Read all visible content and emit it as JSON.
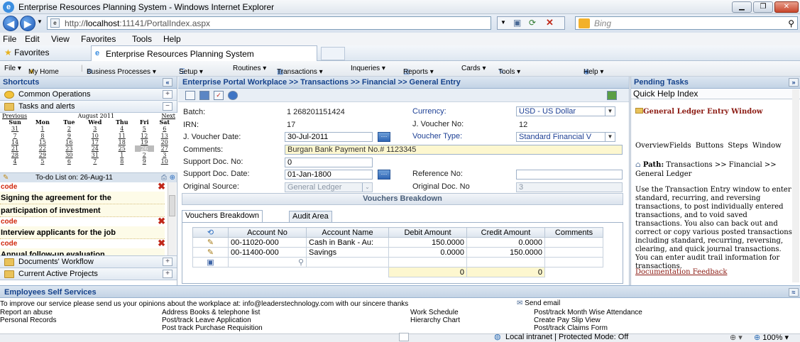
{
  "window": {
    "title": "Enterprise Resources Planning System - Windows Internet Explorer"
  },
  "browser": {
    "url_prefix": "http://",
    "url_host": "localhost",
    "url_path": ":11141/PortalIndex.aspx",
    "search_placeholder": "Bing",
    "tab_title": "Enterprise Resources Planning System",
    "favorites_label": "Favorites"
  },
  "menu": [
    "File",
    "Edit",
    "View",
    "Favorites",
    "Tools",
    "Help"
  ],
  "app_toolbar": [
    "File ▾",
    "My Home",
    "Business Processes ▾",
    "Setup ▾",
    "Routines ▾",
    "Transactions ▾",
    "Inqueries ▾",
    "Reports ▾",
    "Cards ▾",
    "Tools ▾",
    "Help ▾"
  ],
  "shortcuts": {
    "title": "Shortcuts",
    "sections": [
      "Common Operations",
      "Tasks and alerts"
    ],
    "calendar": {
      "prev": "Previous",
      "next": "Next",
      "month": "August 2011",
      "days": [
        "Sun",
        "Mon",
        "Tue",
        "Wed",
        "Thu",
        "Fri",
        "Sat"
      ],
      "weeks": [
        [
          "31",
          "1",
          "2",
          "3",
          "4",
          "5",
          "6"
        ],
        [
          "7",
          "8",
          "9",
          "10",
          "11",
          "12",
          "13"
        ],
        [
          "14",
          "15",
          "16",
          "17",
          "18",
          "19",
          "20"
        ],
        [
          "21",
          "22",
          "23",
          "24",
          "25",
          "26",
          "27"
        ],
        [
          "28",
          "29",
          "30",
          "31",
          "1",
          "2",
          "3"
        ],
        [
          "4",
          "5",
          "6",
          "7",
          "8",
          "9",
          "10"
        ]
      ]
    },
    "todo": "To-do List on: 26-Aug-11",
    "notes": [
      {
        "tag": "code",
        "text": "Signing the agreement for the"
      },
      {
        "tag": "",
        "text": "participation of investment"
      },
      {
        "tag": "code",
        "text": "Interview applicants for the job"
      },
      {
        "tag": "code",
        "text": "Annual follow-up evaluation"
      }
    ],
    "bottom_sections": [
      "Documents' Workflow",
      "Current Active Projects"
    ]
  },
  "breadcrumb": "Enterprise Portal Workplace >> Transactions >> Financial >> General Entry",
  "form": {
    "batch_label": "Batch:",
    "batch": "1 268201151424",
    "irn_label": "IRN:",
    "irn": "17",
    "jvdate_label": "J. Voucher Date:",
    "jvdate": "30-Jul-2011",
    "comments_label": "Comments:",
    "comments": "Burgan Bank Payment No.# 1123345",
    "supdoc_label": "Support Doc. No:",
    "supdoc": "0",
    "supdate_label": "Support Doc. Date:",
    "supdate": "01-Jan-1800",
    "origsrc_label": "Original Source:",
    "origsrc": "General Ledger",
    "currency_label": "Currency:",
    "currency": "USD - US Dollar",
    "jvno_label": "J. Voucher No:",
    "jvno": "12",
    "vtype_label": "Voucher Type:",
    "vtype": "Standard Financial V",
    "ref_label": "Reference No:",
    "ref": "",
    "origdoc_label": "Original Doc. No",
    "origdoc": "3"
  },
  "vouchers": {
    "title": "Vouchers Breakdown",
    "tabs": [
      "Vouchers Breakdown",
      "Audit Area"
    ],
    "columns": [
      "Account No",
      "Account Name",
      "Debit Amount",
      "Credit Amount",
      "Comments"
    ],
    "rows": [
      [
        "00-11020-000",
        "Cash in Bank - Au:",
        "150.0000",
        "0.0000",
        ""
      ],
      [
        "00-11400-000",
        "Savings",
        "0.0000",
        "150.0000",
        ""
      ]
    ],
    "totals": [
      "0",
      "0"
    ]
  },
  "pending": {
    "title": "Pending Tasks",
    "quick_help": "Quick Help Index",
    "heading": "General Ledger Entry Window",
    "links": "OverviewFields  Buttons Steps  Window",
    "path_label": "Path:",
    "path": "Transactions >> Financial >> General Ledger",
    "body": "Use the Transaction Entry window to enter standard, recurring, and reversing transactions, to post individually entered transactions, and to void saved transactions. You also can back out and correct or copy various posted transactions, including standard, recurring, reversing, clearing, and quick journal transactions. You can enter audit trail information for transactions.",
    "feedback": "Documentation Feedback"
  },
  "employees": {
    "title": "Employees Self Services",
    "intro": "To improve our service please send us your opinions about the workplace at: info@leaderstechnology.com with our sincere thanks",
    "send_email": "Send email",
    "col1": [
      "Report an abuse",
      "Personal Records"
    ],
    "col2": [
      "Address Books & telephone list",
      "Post/track Leave Application",
      "Post track Purchase Requisition"
    ],
    "col3": [
      "Work Schedule",
      "Hierarchy Chart"
    ],
    "col4": [
      "Post/track Month Wise Attendance",
      "Create Pay Slip View",
      "Post/track Claims Form"
    ]
  },
  "status": {
    "zone": "Local intranet | Protected Mode: Off",
    "zoom": "100%"
  }
}
